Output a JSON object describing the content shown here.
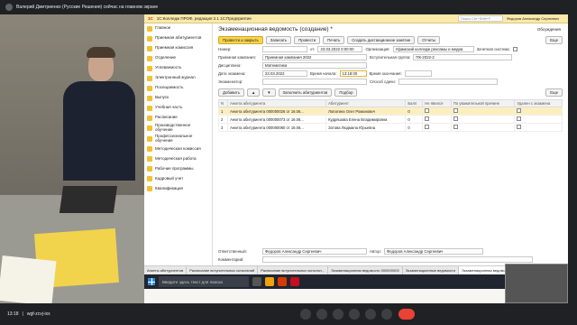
{
  "meet": {
    "banner": "Валерий Дмитриенко (Русские Решения) сейчас на главном экране",
    "time": "13:18",
    "meeting_code": "wgf-zcvj-ixx"
  },
  "app": {
    "title": "1С:Колледж ПРОФ, редакция 2.1 1С:Предприятие",
    "search_placeholder": "Поиск Ctrl+Shift+F",
    "user": "Федоров Александр Сергеевич"
  },
  "nav": [
    "Главное",
    "Приемная абитуриентов",
    "Приемная комиссия",
    "Отделение",
    "Успеваемость",
    "Электронный журнал",
    "Посещаемость",
    "Выпуск",
    "Учебная часть",
    "Расписание",
    "Производственное обучение",
    "Профессиональное обучение",
    "Методическая комиссия",
    "Методическая работа",
    "Рабочие программы",
    "Кадровый учет",
    "Квалификация"
  ],
  "form": {
    "title": "Экзаменационная ведомость (создание) *",
    "discuss": "Обсуждения",
    "btn_post_close": "Провести и закрыть",
    "btn_save": "Записать",
    "btn_post": "Провести",
    "btn_print": "Печать",
    "btn_create_remote": "Создать дистанционное занятие",
    "btn_reports": "Отчеты",
    "btn_more": "Еще",
    "lbl_number": "Номер:",
    "lbl_from": "от:",
    "val_date": "23.03.2022 0:00:00",
    "lbl_org": "Организация:",
    "val_org": "Уфимский колледж рекламы и медиа",
    "lbl_retake": "Зачетная система:",
    "lbl_campaign": "Приемная кампания:",
    "val_campaign": "Приемная кампания 2022",
    "lbl_group": "Вступительная группа:",
    "val_group": "ПК-2022-2",
    "lbl_subject": "Дисциплина:",
    "val_subject": "Математика",
    "lbl_exam_date": "Дата экзамена:",
    "val_exam_date": "23.03.2022",
    "lbl_time_start": "Время начала:",
    "val_time_start": "13:18:00",
    "lbl_time_end": "Время окончания:",
    "lbl_examiner": "Экзаменатор:",
    "lbl_method": "Способ сдачи:",
    "btn_add": "Добавить",
    "btn_fill": "Заполнить абитуриентов",
    "btn_select": "Подбор",
    "btn_more2": "Еще",
    "columns": [
      "N",
      "Анкета абитуриента",
      "Абитуриент",
      "Балл",
      "Не явился",
      "По уважительной причине",
      "Удален с экзамена"
    ],
    "rows": [
      {
        "n": "1",
        "anketa": "Анкета абитуриента 000000026 от 16.06...",
        "name": "Лопатина Олег Романович",
        "score": "0"
      },
      {
        "n": "2",
        "anketa": "Анкета абитуриента 000000073 от 16.06...",
        "name": "Кудряшова Елена Владимировна",
        "score": "0"
      },
      {
        "n": "3",
        "anketa": "Анкета абитуриента 000000080 от 16.06...",
        "name": "Зотова Людмила Юрьевна",
        "score": "0"
      }
    ],
    "lbl_responsible": "Ответственный:",
    "val_responsible": "Федоров Александр Сергеевич",
    "lbl_author": "Автор:",
    "val_author": "Федоров Александр Сергеевич",
    "lbl_comment": "Комментарий:"
  },
  "win_tabs": [
    "Анкеты абитуриентов",
    "Расписание вступительных испытаний",
    "Расписание вступительных испытан...",
    "Экзаменационная ведомость 000000003",
    "Экзаменационные ведомости",
    "Экзаменационная ведомость"
  ],
  "taskbar": {
    "search_placeholder": "Введите здесь текст для поиска"
  }
}
